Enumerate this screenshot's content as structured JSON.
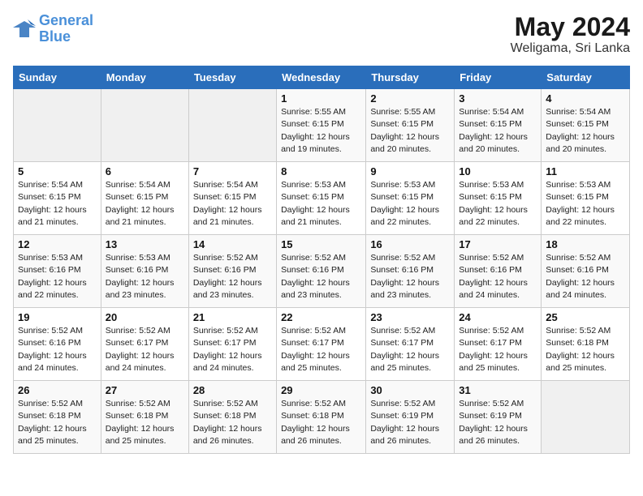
{
  "header": {
    "logo_line1": "General",
    "logo_line2": "Blue",
    "month_year": "May 2024",
    "location": "Weligama, Sri Lanka"
  },
  "weekdays": [
    "Sunday",
    "Monday",
    "Tuesday",
    "Wednesday",
    "Thursday",
    "Friday",
    "Saturday"
  ],
  "weeks": [
    [
      {
        "day": "",
        "info": ""
      },
      {
        "day": "",
        "info": ""
      },
      {
        "day": "",
        "info": ""
      },
      {
        "day": "1",
        "info": "Sunrise: 5:55 AM\nSunset: 6:15 PM\nDaylight: 12 hours\nand 19 minutes."
      },
      {
        "day": "2",
        "info": "Sunrise: 5:55 AM\nSunset: 6:15 PM\nDaylight: 12 hours\nand 20 minutes."
      },
      {
        "day": "3",
        "info": "Sunrise: 5:54 AM\nSunset: 6:15 PM\nDaylight: 12 hours\nand 20 minutes."
      },
      {
        "day": "4",
        "info": "Sunrise: 5:54 AM\nSunset: 6:15 PM\nDaylight: 12 hours\nand 20 minutes."
      }
    ],
    [
      {
        "day": "5",
        "info": "Sunrise: 5:54 AM\nSunset: 6:15 PM\nDaylight: 12 hours\nand 21 minutes."
      },
      {
        "day": "6",
        "info": "Sunrise: 5:54 AM\nSunset: 6:15 PM\nDaylight: 12 hours\nand 21 minutes."
      },
      {
        "day": "7",
        "info": "Sunrise: 5:54 AM\nSunset: 6:15 PM\nDaylight: 12 hours\nand 21 minutes."
      },
      {
        "day": "8",
        "info": "Sunrise: 5:53 AM\nSunset: 6:15 PM\nDaylight: 12 hours\nand 21 minutes."
      },
      {
        "day": "9",
        "info": "Sunrise: 5:53 AM\nSunset: 6:15 PM\nDaylight: 12 hours\nand 22 minutes."
      },
      {
        "day": "10",
        "info": "Sunrise: 5:53 AM\nSunset: 6:15 PM\nDaylight: 12 hours\nand 22 minutes."
      },
      {
        "day": "11",
        "info": "Sunrise: 5:53 AM\nSunset: 6:15 PM\nDaylight: 12 hours\nand 22 minutes."
      }
    ],
    [
      {
        "day": "12",
        "info": "Sunrise: 5:53 AM\nSunset: 6:16 PM\nDaylight: 12 hours\nand 22 minutes."
      },
      {
        "day": "13",
        "info": "Sunrise: 5:53 AM\nSunset: 6:16 PM\nDaylight: 12 hours\nand 23 minutes."
      },
      {
        "day": "14",
        "info": "Sunrise: 5:52 AM\nSunset: 6:16 PM\nDaylight: 12 hours\nand 23 minutes."
      },
      {
        "day": "15",
        "info": "Sunrise: 5:52 AM\nSunset: 6:16 PM\nDaylight: 12 hours\nand 23 minutes."
      },
      {
        "day": "16",
        "info": "Sunrise: 5:52 AM\nSunset: 6:16 PM\nDaylight: 12 hours\nand 23 minutes."
      },
      {
        "day": "17",
        "info": "Sunrise: 5:52 AM\nSunset: 6:16 PM\nDaylight: 12 hours\nand 24 minutes."
      },
      {
        "day": "18",
        "info": "Sunrise: 5:52 AM\nSunset: 6:16 PM\nDaylight: 12 hours\nand 24 minutes."
      }
    ],
    [
      {
        "day": "19",
        "info": "Sunrise: 5:52 AM\nSunset: 6:16 PM\nDaylight: 12 hours\nand 24 minutes."
      },
      {
        "day": "20",
        "info": "Sunrise: 5:52 AM\nSunset: 6:17 PM\nDaylight: 12 hours\nand 24 minutes."
      },
      {
        "day": "21",
        "info": "Sunrise: 5:52 AM\nSunset: 6:17 PM\nDaylight: 12 hours\nand 24 minutes."
      },
      {
        "day": "22",
        "info": "Sunrise: 5:52 AM\nSunset: 6:17 PM\nDaylight: 12 hours\nand 25 minutes."
      },
      {
        "day": "23",
        "info": "Sunrise: 5:52 AM\nSunset: 6:17 PM\nDaylight: 12 hours\nand 25 minutes."
      },
      {
        "day": "24",
        "info": "Sunrise: 5:52 AM\nSunset: 6:17 PM\nDaylight: 12 hours\nand 25 minutes."
      },
      {
        "day": "25",
        "info": "Sunrise: 5:52 AM\nSunset: 6:18 PM\nDaylight: 12 hours\nand 25 minutes."
      }
    ],
    [
      {
        "day": "26",
        "info": "Sunrise: 5:52 AM\nSunset: 6:18 PM\nDaylight: 12 hours\nand 25 minutes."
      },
      {
        "day": "27",
        "info": "Sunrise: 5:52 AM\nSunset: 6:18 PM\nDaylight: 12 hours\nand 25 minutes."
      },
      {
        "day": "28",
        "info": "Sunrise: 5:52 AM\nSunset: 6:18 PM\nDaylight: 12 hours\nand 26 minutes."
      },
      {
        "day": "29",
        "info": "Sunrise: 5:52 AM\nSunset: 6:18 PM\nDaylight: 12 hours\nand 26 minutes."
      },
      {
        "day": "30",
        "info": "Sunrise: 5:52 AM\nSunset: 6:19 PM\nDaylight: 12 hours\nand 26 minutes."
      },
      {
        "day": "31",
        "info": "Sunrise: 5:52 AM\nSunset: 6:19 PM\nDaylight: 12 hours\nand 26 minutes."
      },
      {
        "day": "",
        "info": ""
      }
    ]
  ]
}
